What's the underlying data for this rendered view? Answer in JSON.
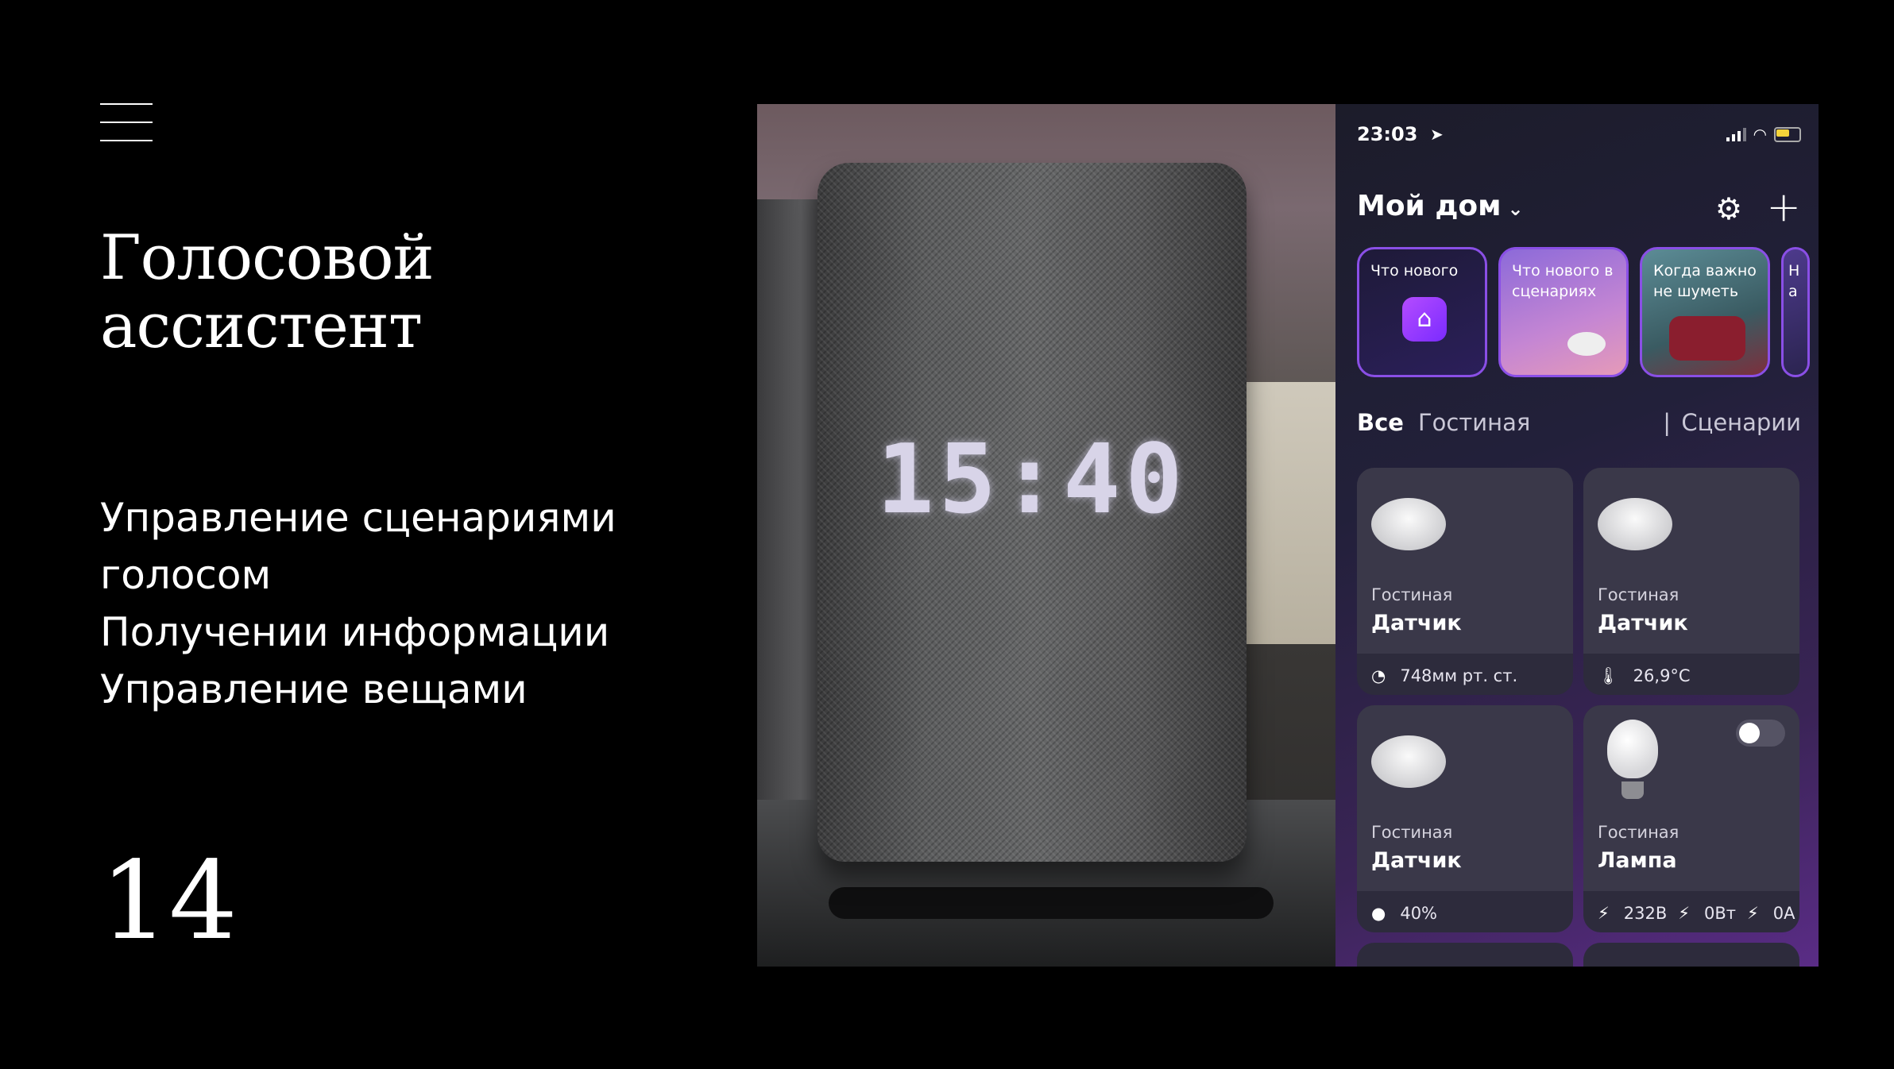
{
  "slide": {
    "title_lines": [
      "Голосовой",
      "ассистент"
    ],
    "bullets": [
      "Управление сценариями",
      "голосом",
      "Получении информации",
      "Управление вещами"
    ],
    "page_number": "14"
  },
  "photo": {
    "clock_display": "15:40"
  },
  "phone": {
    "status_time": "23:03",
    "home_title": "Мой дом",
    "stories": [
      "Что нового",
      "Что нового в сценариях",
      "Когда важно не шуметь",
      "На эк"
    ],
    "tabs": {
      "all": "Все",
      "room": "Гостиная",
      "separator": "|",
      "scenarios": "Сценарии"
    },
    "devices": [
      {
        "room": "Гостиная",
        "name": "Датчик",
        "metric": "748мм рт. ст.",
        "icon": "pressure-icon"
      },
      {
        "room": "Гостиная",
        "name": "Датчик",
        "metric": "26,9°C",
        "icon": "thermometer-icon"
      },
      {
        "room": "Гостиная",
        "name": "Датчик",
        "metric": "40%",
        "icon": "drop-icon"
      },
      {
        "room": "Гостиная",
        "name": "Лампа",
        "metrics": [
          "232В",
          "0Вт",
          "0А"
        ],
        "icon": "bolt-icon",
        "toggle_on": false
      }
    ]
  },
  "colors": {
    "background": "#000000",
    "accent_purple": "#8a4fe6",
    "card_bg": "#2d2b3c"
  }
}
